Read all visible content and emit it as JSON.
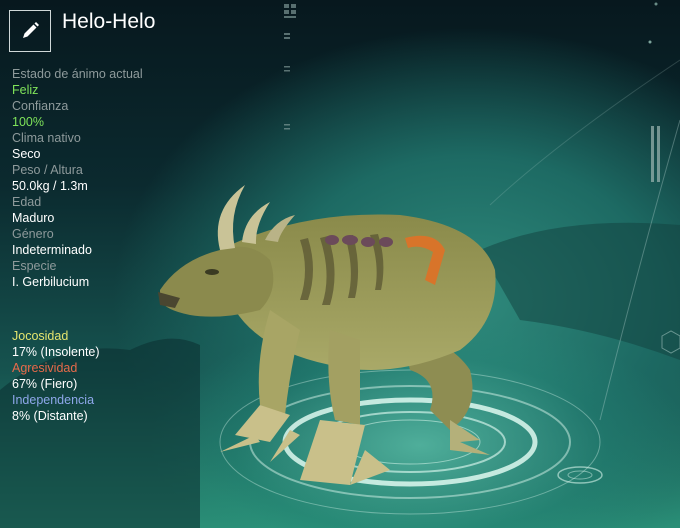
{
  "creature": {
    "name": "Helo-Helo",
    "edit_icon": "pencil-icon"
  },
  "stats": [
    {
      "label": "Estado de ánimo actual",
      "value": "Feliz",
      "value_color": "#7fe35a"
    },
    {
      "label": "Confianza",
      "value": "100%",
      "value_color": "#7fe35a"
    },
    {
      "label": "Clima nativo",
      "value": "Seco",
      "value_color": "#ffffff"
    },
    {
      "label": "Peso / Altura",
      "value": "50.0kg / 1.3m",
      "value_color": "#ffffff"
    },
    {
      "label": "Edad",
      "value": "Maduro",
      "value_color": "#ffffff"
    },
    {
      "label": "Género",
      "value": "Indeterminado",
      "value_color": "#ffffff"
    },
    {
      "label": "Especie",
      "value": "I. Gerbilucium",
      "value_color": "#ffffff"
    }
  ],
  "traits": [
    {
      "label": "Jocosidad",
      "value": "17% (Insolente)",
      "label_color": "#e4e56e"
    },
    {
      "label": "Agresividad",
      "value": "67% (Fiero)",
      "label_color": "#e76a4a"
    },
    {
      "label": "Independencia",
      "value": "8% (Distante)",
      "label_color": "#8ea7ea"
    }
  ]
}
